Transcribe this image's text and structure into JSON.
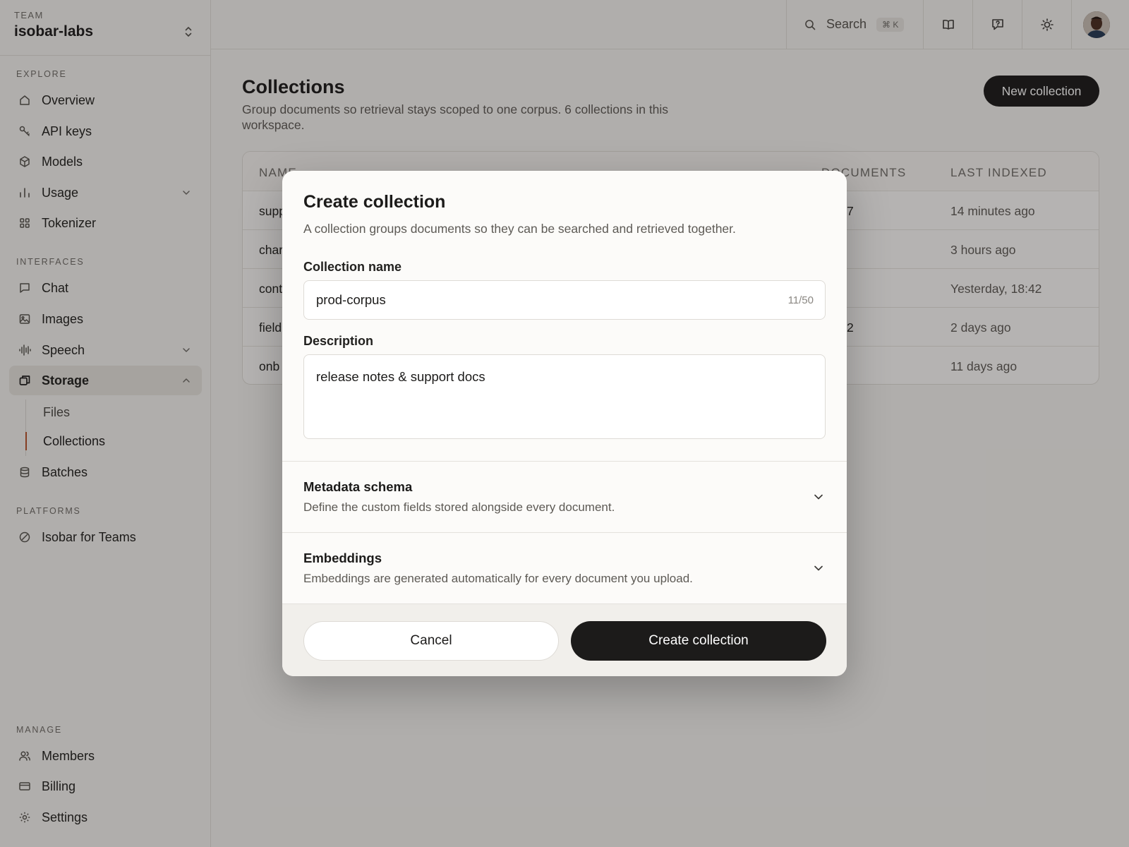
{
  "team": {
    "label": "TEAM",
    "name": "isobar-labs"
  },
  "sidebar": {
    "explore_label": "EXPLORE",
    "interfaces_label": "INTERFACES",
    "platforms_label": "PLATFORMS",
    "manage_label": "MANAGE",
    "items": {
      "overview": "Overview",
      "api_keys": "API keys",
      "models": "Models",
      "usage": "Usage",
      "tokenizer": "Tokenizer",
      "chat": "Chat",
      "images": "Images",
      "speech": "Speech",
      "storage": "Storage",
      "files": "Files",
      "collections": "Collections",
      "batches": "Batches",
      "teams": "Isobar for Teams",
      "members": "Members",
      "billing": "Billing",
      "settings": "Settings"
    }
  },
  "topbar": {
    "search_label": "Search",
    "search_shortcut": "⌘ K"
  },
  "page": {
    "title": "Collections",
    "description": "Group documents so retrieval stays scoped to one corpus. 6 collections in this workspace.",
    "new_button": "New collection"
  },
  "table": {
    "headers": {
      "name": "NAME",
      "documents": "DOCUMENTS",
      "last_indexed": "LAST INDEXED"
    },
    "rows": [
      {
        "name": "supp",
        "documents": "7",
        "last_indexed": "14 minutes ago"
      },
      {
        "name": "char",
        "documents": "",
        "last_indexed": "3 hours ago"
      },
      {
        "name": "cont",
        "documents": "",
        "last_indexed": "Yesterday, 18:42"
      },
      {
        "name": "field",
        "documents": "2",
        "last_indexed": "2 days ago"
      },
      {
        "name": "onb",
        "documents": "",
        "last_indexed": "11 days ago"
      }
    ]
  },
  "modal": {
    "title": "Create collection",
    "description": "A collection groups documents so they can be searched and retrieved together.",
    "name_label": "Collection name",
    "name_value": "prod-corpus",
    "name_count": "11/50",
    "desc_label": "Description",
    "desc_value": "release notes & support docs",
    "metadata_title": "Metadata schema",
    "metadata_desc": "Define the custom fields stored alongside every document.",
    "embeddings_title": "Embeddings",
    "embeddings_desc": "Embeddings are generated automatically for every document you upload.",
    "cancel": "Cancel",
    "create": "Create collection"
  },
  "colors": {
    "accent": "#b7522a",
    "primary": "#1c1b1a",
    "background": "#f4f2ef"
  }
}
